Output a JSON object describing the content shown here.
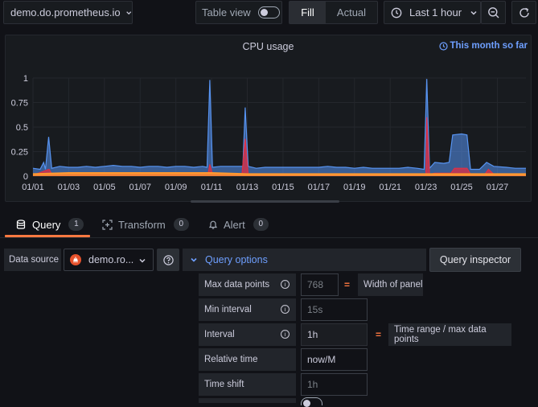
{
  "toolbar": {
    "datasource_name": "demo.do.prometheus.io",
    "table_view_label": "Table view",
    "fill_label": "Fill",
    "actual_label": "Actual",
    "time_range_label": "Last 1 hour"
  },
  "panel": {
    "title": "CPU usage",
    "time_info": "This month so far"
  },
  "tabs": [
    {
      "label": "Query",
      "count": "1"
    },
    {
      "label": "Transform",
      "count": "0"
    },
    {
      "label": "Alert",
      "count": "0"
    }
  ],
  "query_row": {
    "data_source_label": "Data source",
    "data_source_value": "demo.ro...",
    "query_options_label": "Query options",
    "query_inspector_label": "Query inspector"
  },
  "options": {
    "max_data_points": {
      "label": "Max data points",
      "value": "768",
      "note": "Width of panel"
    },
    "min_interval": {
      "label": "Min interval",
      "value": "15s"
    },
    "interval": {
      "label": "Interval",
      "value": "1h",
      "note": "Time range / max data points"
    },
    "relative_time": {
      "label": "Relative time",
      "value": "now/M"
    },
    "time_shift": {
      "label": "Time shift",
      "value": "1h"
    }
  },
  "colors": {
    "series_blue": "#5794f2",
    "series_red": "#e02f44",
    "series_orange": "#ff9830",
    "accent_link": "#6e9fff",
    "tab_active": "#ff7941"
  },
  "chart_data": {
    "type": "area",
    "title": "CPU usage",
    "x": [
      "01/01",
      "01/03",
      "01/05",
      "01/07",
      "01/09",
      "01/11",
      "01/13",
      "01/15",
      "01/17",
      "01/19",
      "01/21",
      "01/23",
      "01/25",
      "01/27"
    ],
    "y_ticks": [
      "0",
      "0.25",
      "0.5",
      "0.75",
      "1"
    ],
    "ylim": [
      0,
      1
    ],
    "series": [
      {
        "color_key": "series_blue",
        "points": [
          [
            1,
            0.08
          ],
          [
            1.4,
            0.07
          ],
          [
            1.6,
            0.14
          ],
          [
            1.7,
            0.07
          ],
          [
            1.88,
            0.4
          ],
          [
            2.05,
            0.08
          ],
          [
            2.5,
            0.1
          ],
          [
            3,
            0.09
          ],
          [
            3.5,
            0.09
          ],
          [
            4,
            0.1
          ],
          [
            4.5,
            0.09
          ],
          [
            5,
            0.1
          ],
          [
            5.5,
            0.11
          ],
          [
            6,
            0.1
          ],
          [
            6.5,
            0.1
          ],
          [
            7,
            0.09
          ],
          [
            7.5,
            0.1
          ],
          [
            8,
            0.1
          ],
          [
            8.5,
            0.09
          ],
          [
            9,
            0.1
          ],
          [
            9.5,
            0.1
          ],
          [
            10,
            0.09
          ],
          [
            10.5,
            0.1
          ],
          [
            10.75,
            0.09
          ],
          [
            10.9,
            0.98
          ],
          [
            11.05,
            0.09
          ],
          [
            11.5,
            0.1
          ],
          [
            12,
            0.1
          ],
          [
            12.5,
            0.1
          ],
          [
            12.75,
            0.1
          ],
          [
            12.88,
            0.7
          ],
          [
            13.05,
            0.1
          ],
          [
            13.5,
            0.08
          ],
          [
            14,
            0.09
          ],
          [
            14.5,
            0.09
          ],
          [
            15,
            0.09
          ],
          [
            15.5,
            0.09
          ],
          [
            16,
            0.09
          ],
          [
            16.5,
            0.09
          ],
          [
            17,
            0.09
          ],
          [
            17.5,
            0.1
          ],
          [
            18,
            0.09
          ],
          [
            18.5,
            0.09
          ],
          [
            19,
            0.08
          ],
          [
            19.5,
            0.09
          ],
          [
            20,
            0.08
          ],
          [
            20.5,
            0.08
          ],
          [
            21,
            0.08
          ],
          [
            21.5,
            0.08
          ],
          [
            22,
            0.09
          ],
          [
            22.5,
            0.08
          ],
          [
            22.9,
            0.07
          ],
          [
            23.05,
            0.99
          ],
          [
            23.2,
            0.08
          ],
          [
            23.5,
            0.14
          ],
          [
            24,
            0.13
          ],
          [
            24.3,
            0.14
          ],
          [
            24.5,
            0.42
          ],
          [
            25,
            0.43
          ],
          [
            25.3,
            0.42
          ],
          [
            25.5,
            0.07
          ],
          [
            26,
            0.07
          ],
          [
            26.4,
            0.14
          ],
          [
            26.8,
            0.1
          ],
          [
            27.5,
            0.09
          ],
          [
            28,
            0.08
          ],
          [
            28.6,
            0.08
          ]
        ]
      },
      {
        "color_key": "series_red",
        "points": [
          [
            1,
            0.01
          ],
          [
            1.9,
            0.07
          ],
          [
            2.1,
            0.01
          ],
          [
            5,
            0.02
          ],
          [
            10.8,
            0.02
          ],
          [
            10.9,
            0.12
          ],
          [
            11.05,
            0.02
          ],
          [
            12.7,
            0.02
          ],
          [
            12.88,
            0.38
          ],
          [
            13.05,
            0.02
          ],
          [
            23,
            0.02
          ],
          [
            23.05,
            0.6
          ],
          [
            23.2,
            0.02
          ],
          [
            23.5,
            0.03
          ],
          [
            24.4,
            0.03
          ],
          [
            24.6,
            0.08
          ],
          [
            25.3,
            0.08
          ],
          [
            25.5,
            0.02
          ],
          [
            26.3,
            0.02
          ],
          [
            26.5,
            0.07
          ],
          [
            26.8,
            0.02
          ],
          [
            28.6,
            0.02
          ]
        ]
      },
      {
        "color_key": "series_orange",
        "points": [
          [
            1,
            0.02
          ],
          [
            3,
            0.03
          ],
          [
            5,
            0.03
          ],
          [
            7,
            0.03
          ],
          [
            9,
            0.03
          ],
          [
            11,
            0.03
          ],
          [
            13,
            0.02
          ],
          [
            15,
            0.02
          ],
          [
            17,
            0.02
          ],
          [
            19,
            0.02
          ],
          [
            21,
            0.02
          ],
          [
            23,
            0.02
          ],
          [
            25,
            0.02
          ],
          [
            27,
            0.02
          ],
          [
            28.6,
            0.02
          ]
        ]
      }
    ]
  }
}
